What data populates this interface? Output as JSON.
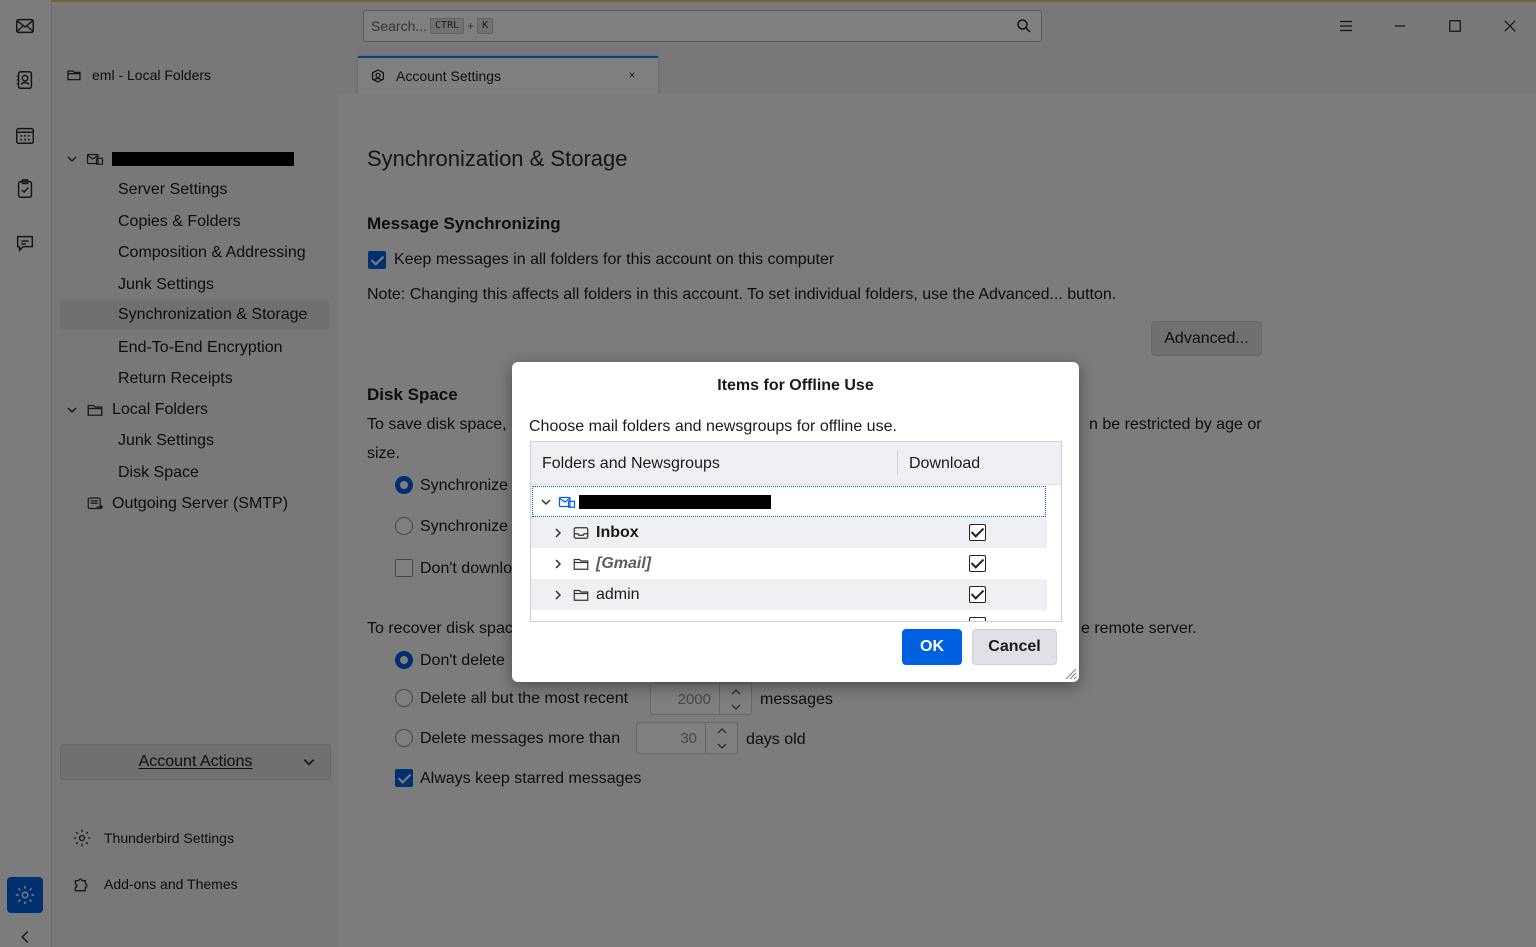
{
  "search": {
    "placeholder": "Search...",
    "key1": "CTRL",
    "key2": "K",
    "plus": "+"
  },
  "tabs": [
    {
      "label": "eml - Local Folders"
    },
    {
      "label": "Account Settings"
    }
  ],
  "sidebar": {
    "account_children": [
      "Server Settings",
      "Copies & Folders",
      "Composition & Addressing",
      "Junk Settings",
      "Synchronization & Storage",
      "End-To-End Encryption",
      "Return Receipts"
    ],
    "local_folders": "Local Folders",
    "local_children": [
      "Junk Settings",
      "Disk Space"
    ],
    "outgoing": "Outgoing Server (SMTP)",
    "account_actions": "Account Actions",
    "thunderbird_settings": "Thunderbird Settings",
    "addons": "Add-ons and Themes"
  },
  "main": {
    "title": "Synchronization & Storage",
    "sync_heading": "Message Synchronizing",
    "keep_messages": "Keep messages in all folders for this account on this computer",
    "note": "Note: Changing this affects all folders in this account. To set individual folders, use the Advanced... button.",
    "advanced": "Advanced...",
    "disk_heading": "Disk Space",
    "disk_line1_a": "To save disk space, d",
    "disk_line1_b": "n be restricted by age or",
    "disk_line2": "size.",
    "sync_opt1": "Synchronize a",
    "sync_opt2": "Synchronize t",
    "dont_download": "Don't downlo",
    "recover_a": "To recover disk space",
    "recover_b": "e remote server.",
    "dont_delete": "Don't delete",
    "delete_recent": "Delete all but the most recent",
    "recent_value": "2000",
    "messages": "messages",
    "delete_older": "Delete messages more than",
    "older_value": "30",
    "days_old": "days old",
    "keep_starred": "Always keep starred messages"
  },
  "dialog": {
    "title": "Items for Offline Use",
    "description": "Choose mail folders and newsgroups for offline use.",
    "col_folders": "Folders and Newsgroups",
    "col_download": "Download",
    "rows": [
      {
        "label": "Inbox",
        "checked": true
      },
      {
        "label": "[Gmail]",
        "checked": true
      },
      {
        "label": "admin",
        "checked": true
      }
    ],
    "ok": "OK",
    "cancel": "Cancel"
  },
  "colors": {
    "accent": "#0061e0",
    "overlay": "rgba(0,0,0,0.5)"
  }
}
